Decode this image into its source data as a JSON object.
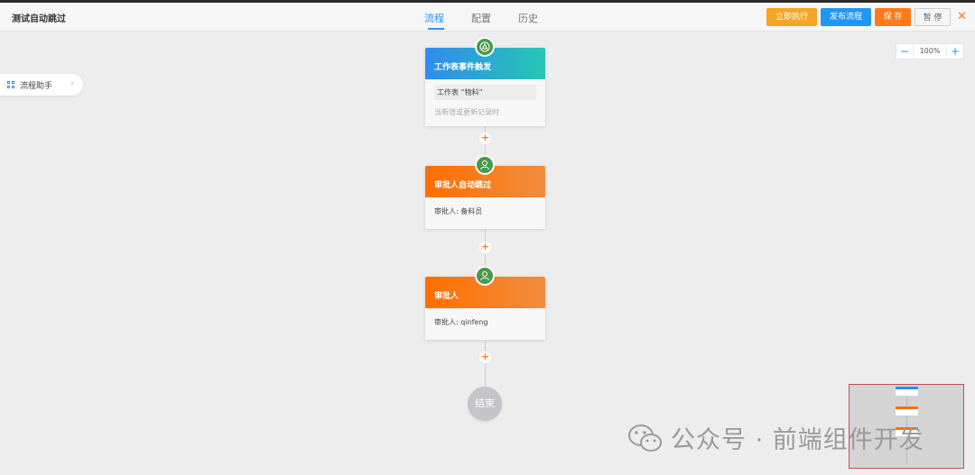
{
  "app": {
    "title": "测试自动跳过"
  },
  "tabs": [
    {
      "label": "流程",
      "active": true
    },
    {
      "label": "配置",
      "active": false
    },
    {
      "label": "历史",
      "active": false
    }
  ],
  "actions": {
    "run_label": "立即执行",
    "publish_label": "发布流程",
    "save_label": "保 存",
    "pause_label": "暂 停",
    "close_icon": "close-icon"
  },
  "zoom": {
    "minus": "−",
    "value": "100%",
    "plus": "+"
  },
  "helper": {
    "label": "流程助手",
    "chevron": "›"
  },
  "nodes": [
    {
      "title": "工作表事件触发",
      "kind": "trigger",
      "chip": "工作表 “物料”",
      "detail": "当新增或更新记录时",
      "icon": "trigger-icon"
    },
    {
      "title": "审批人自动跳过",
      "kind": "approver",
      "detail": "审批人: 备料员",
      "icon": "user-icon"
    },
    {
      "title": "审批人",
      "kind": "approver",
      "detail": "审批人: qinfeng",
      "icon": "user-icon"
    }
  ],
  "end": {
    "label": "结束"
  },
  "plus_symbol": "+",
  "watermark": {
    "text": "公众号 · 前端组件开发"
  },
  "colors": {
    "primary": "#2196f3",
    "accent_orange": "#ff7a1a",
    "run_yellow": "#f5a623",
    "node_green": "#4a9a4a",
    "trigger_gradient": [
      "#2f8cf0",
      "#26c6b4"
    ],
    "approver_gradient": [
      "#ff6f00",
      "#f28c3e"
    ]
  }
}
